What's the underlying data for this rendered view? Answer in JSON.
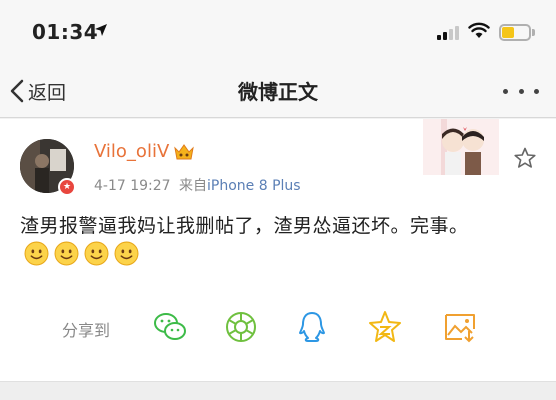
{
  "status_bar": {
    "time": "01:34"
  },
  "nav": {
    "back_label": "返回",
    "title": "微博正文"
  },
  "post": {
    "username": "Vilo_oliV",
    "time": "4-17 19:27",
    "source_prefix": "来自",
    "source": "iPhone 8 Plus",
    "text": "渣男报警逼我妈让我删帖了，渣男怂逼还坏。完事。",
    "emoji_count": 4,
    "emoji_name": "smile-emoji"
  },
  "share": {
    "label": "分享到",
    "targets": [
      "wechat",
      "moments",
      "qq",
      "qzone",
      "save-image"
    ]
  },
  "colors": {
    "username": "#e8733a",
    "link": "#5b7fb5",
    "accent": "#f5c518"
  }
}
